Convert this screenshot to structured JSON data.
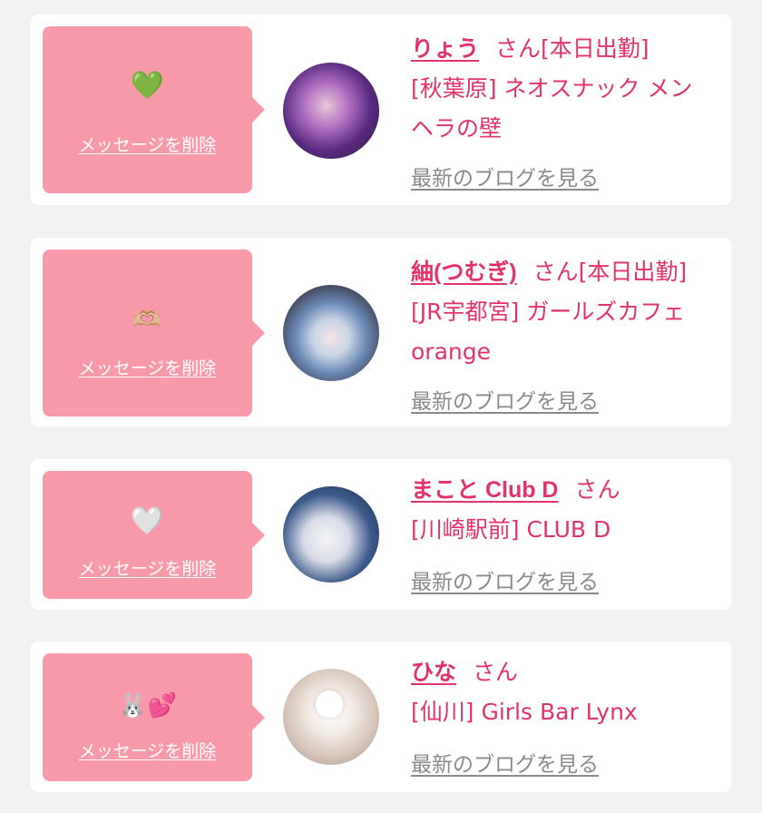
{
  "messages": [
    {
      "emoji": "💚",
      "delete_label": "メッセージを削除",
      "name": "りょう",
      "honorific": "さん",
      "detail_lines": [
        "[本日出勤]",
        "[秋葉原] ネオスナック メン",
        "ヘラの壁"
      ],
      "blog_link": "最新のブログを見る"
    },
    {
      "emoji": "🫶🏼",
      "delete_label": "メッセージを削除",
      "name": "紬(つむぎ)",
      "honorific": "さん",
      "detail_lines": [
        "[本日出勤]",
        "[JR宇都宮] ガールズカフェ",
        "orange"
      ],
      "blog_link": "最新のブログを見る"
    },
    {
      "emoji": "🤍",
      "delete_label": "メッセージを削除",
      "name": "まこと Club D",
      "honorific": "さん",
      "detail_lines": [
        "[川崎駅前] CLUB D"
      ],
      "blog_link": "最新のブログを見る"
    },
    {
      "emoji": "🐰💕",
      "delete_label": "メッセージを削除",
      "name": "ひな",
      "honorific": "さん",
      "detail_lines": [
        "[仙川] Girls Bar Lynx"
      ],
      "blog_link": "最新のブログを見る"
    }
  ],
  "colors": {
    "accent": "#e3336a",
    "message_box": "#f99aaa",
    "muted_link": "#8a8a8a",
    "background": "#f2f2f4"
  }
}
